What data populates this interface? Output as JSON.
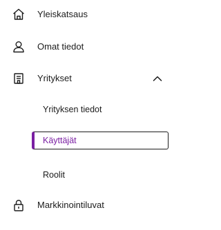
{
  "nav": {
    "items": [
      {
        "label": "Yleiskatsaus",
        "icon": "home-icon"
      },
      {
        "label": "Omat tiedot",
        "icon": "user-icon"
      },
      {
        "label": "Yritykset",
        "icon": "building-icon",
        "expanded": true,
        "children": [
          {
            "label": "Yrityksen tiedot",
            "active": false
          },
          {
            "label": "Käyttäjät",
            "active": true
          },
          {
            "label": "Roolit",
            "active": false
          }
        ]
      },
      {
        "label": "Markkinointiluvat",
        "icon": "lock-icon"
      }
    ]
  },
  "colors": {
    "active_accent": "#7a1fa2",
    "text": "#1b1b1b"
  }
}
